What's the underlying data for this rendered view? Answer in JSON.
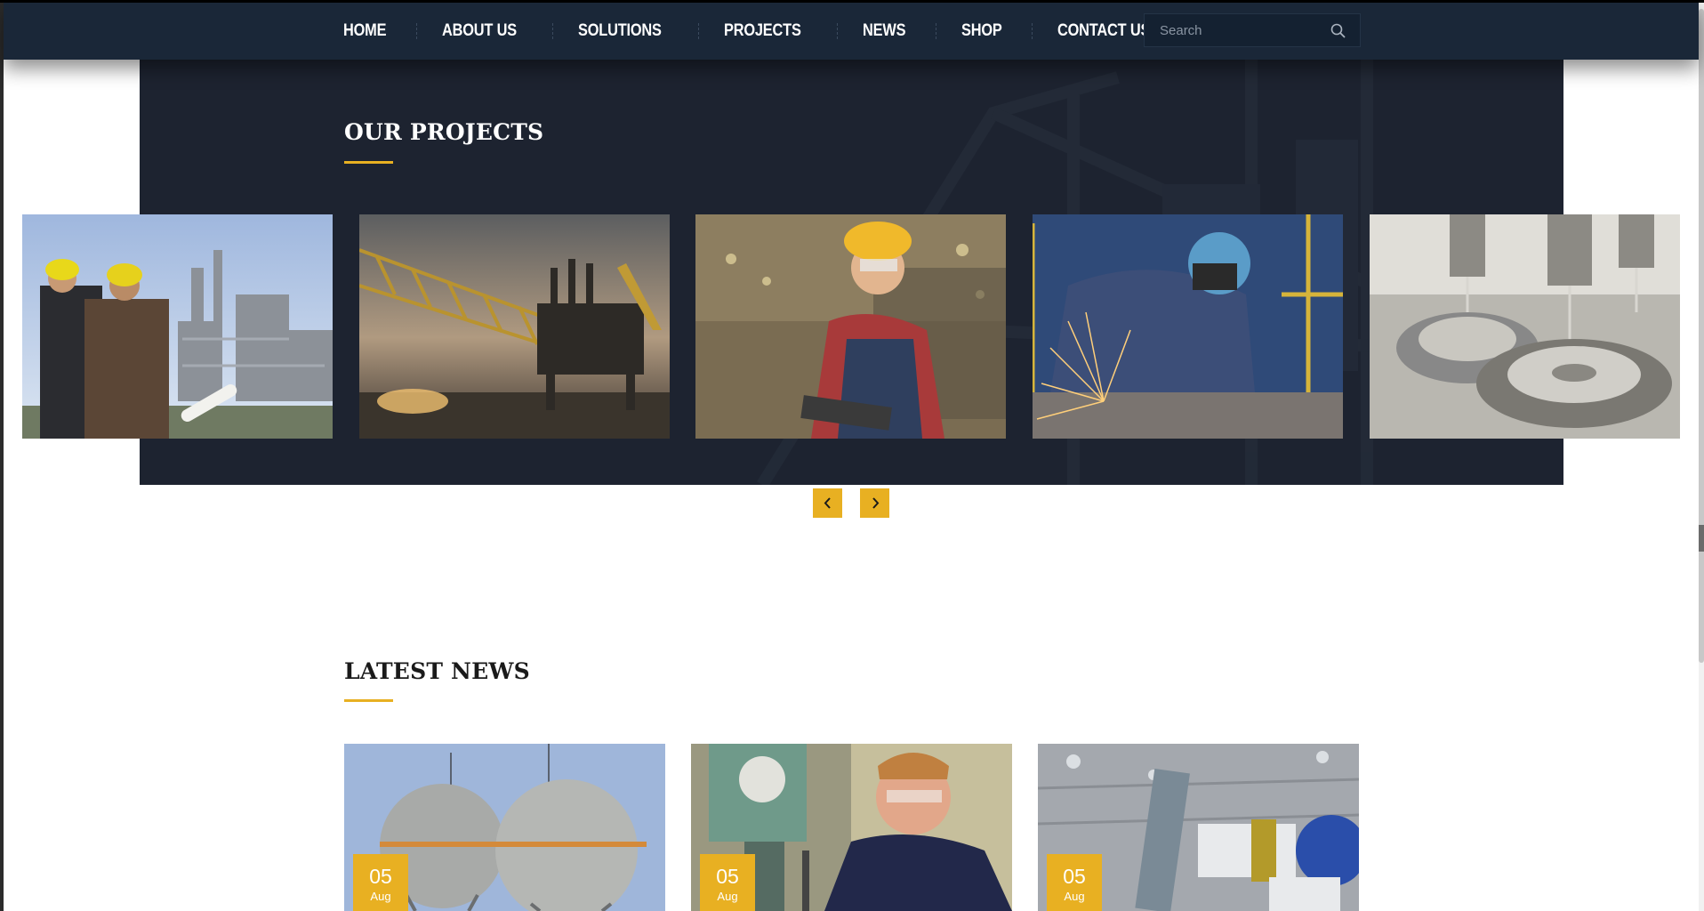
{
  "nav": {
    "items": [
      "HOME",
      "ABOUT US",
      "SOLUTIONS",
      "PROJECTS",
      "NEWS",
      "SHOP",
      "CONTACT US"
    ],
    "search_placeholder": "Search"
  },
  "projects": {
    "title": "OUR PROJECTS",
    "images": [
      "engineers-at-refinery",
      "offshore-oil-platform",
      "woman-worker-with-tablet",
      "welder-with-sparks",
      "cnc-drilling-machine"
    ]
  },
  "news": {
    "title": "LATEST NEWS",
    "items": [
      {
        "image": "spherical-gas-tanks",
        "day": "05",
        "month": "Aug"
      },
      {
        "image": "worker-at-drill-press",
        "day": "05",
        "month": "Aug"
      },
      {
        "image": "industrial-robot-arm",
        "day": "05",
        "month": "Aug"
      }
    ]
  },
  "colors": {
    "nav_bg": "#1a2738",
    "section_bg": "#1d2330",
    "accent": "#e8b022"
  }
}
